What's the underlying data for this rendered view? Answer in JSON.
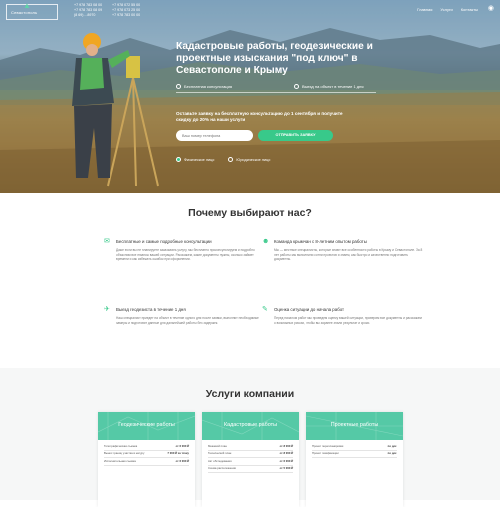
{
  "header": {
    "logo_text": "Севастополь",
    "phones": [
      "+7 978 783 08 00",
      "+7 978 072 55 00",
      "+7 978 783 08 09",
      "+7 978 073 25 00",
      "+7 978 783 00 00",
      "(8 69) ...8970"
    ],
    "nav": [
      "Главная",
      "Услуги",
      "Контакты"
    ]
  },
  "hero": {
    "title": "Кадастровые работы, геодезические и проектные изыскания \"под ключ\" в Севастополе и Крыму",
    "points": [
      "Бесплатная консультация",
      "Выезд на объект в течение 1 дня"
    ],
    "offer": "Оставьте заявку на бесплатную консультацию до 1 сентября и получите скидку до 20% на наши услуги",
    "input_placeholder": "Ваш номер телефона",
    "button_label": "ОТПРАВИТЬ ЗАЯВКУ",
    "radios": [
      "Физическое лицо",
      "Юридическое лицо"
    ]
  },
  "why": {
    "title": "Почему выбирают нас?",
    "items": [
      {
        "title": "Бесплатные и самые подробные консультации",
        "text": "Даже если вы не планируете заказывать услугу, мы бесплатно проконсультируем и подробно объясним все нюансы вашей ситуации. Расскажем, какие документы нужны, сколько займет времени и как избежать ошибок при оформлении."
      },
      {
        "title": "Команда крымчан с 8-летним опытом работы",
        "text": "Мы — местные специалисты, которые знают все особенности работы в Крыму и Севастополе. За 8 лет работы мы выполнили сотни проектов и знаем, как быстро и качественно подготовить документы."
      },
      {
        "title": "Выезд геодезиста в течение 1 дня",
        "text": "Наш специалист приедет на объект в течение одного дня после заявки, выполнит необходимые замеры и подготовит данные для дальнейшей работы без задержек."
      },
      {
        "title": "Оценка ситуации до начала работ",
        "text": "Перед началом работ мы проведем оценку вашей ситуации, проверим все документы и расскажем о возможных рисках, чтобы вы заранее знали результат и сроки."
      }
    ]
  },
  "services": {
    "title": "Услуги компании",
    "cards": [
      {
        "title": "Геодезические работы",
        "rows": [
          [
            "Топографическая съемка",
            "от 6 000 ₽"
          ],
          [
            "Вынос границ участка в натуру",
            "7 000 ₽ за точку"
          ],
          [
            "Исполнительная съемка",
            "от 6 000 ₽"
          ]
        ]
      },
      {
        "title": "Кадастровые работы",
        "rows": [
          [
            "Межевой план",
            "от 8 000 ₽"
          ],
          [
            "Технический план",
            "от 8 000 ₽"
          ],
          [
            "Акт обследования",
            "от 6 000 ₽"
          ],
          [
            "Схема расположения",
            "от 5 000 ₽"
          ]
        ]
      },
      {
        "title": "Проектные работы",
        "rows": [
          [
            "Проект перепланировки",
            "по дог."
          ],
          [
            "Проект газификации",
            "по дог."
          ]
        ]
      }
    ]
  }
}
